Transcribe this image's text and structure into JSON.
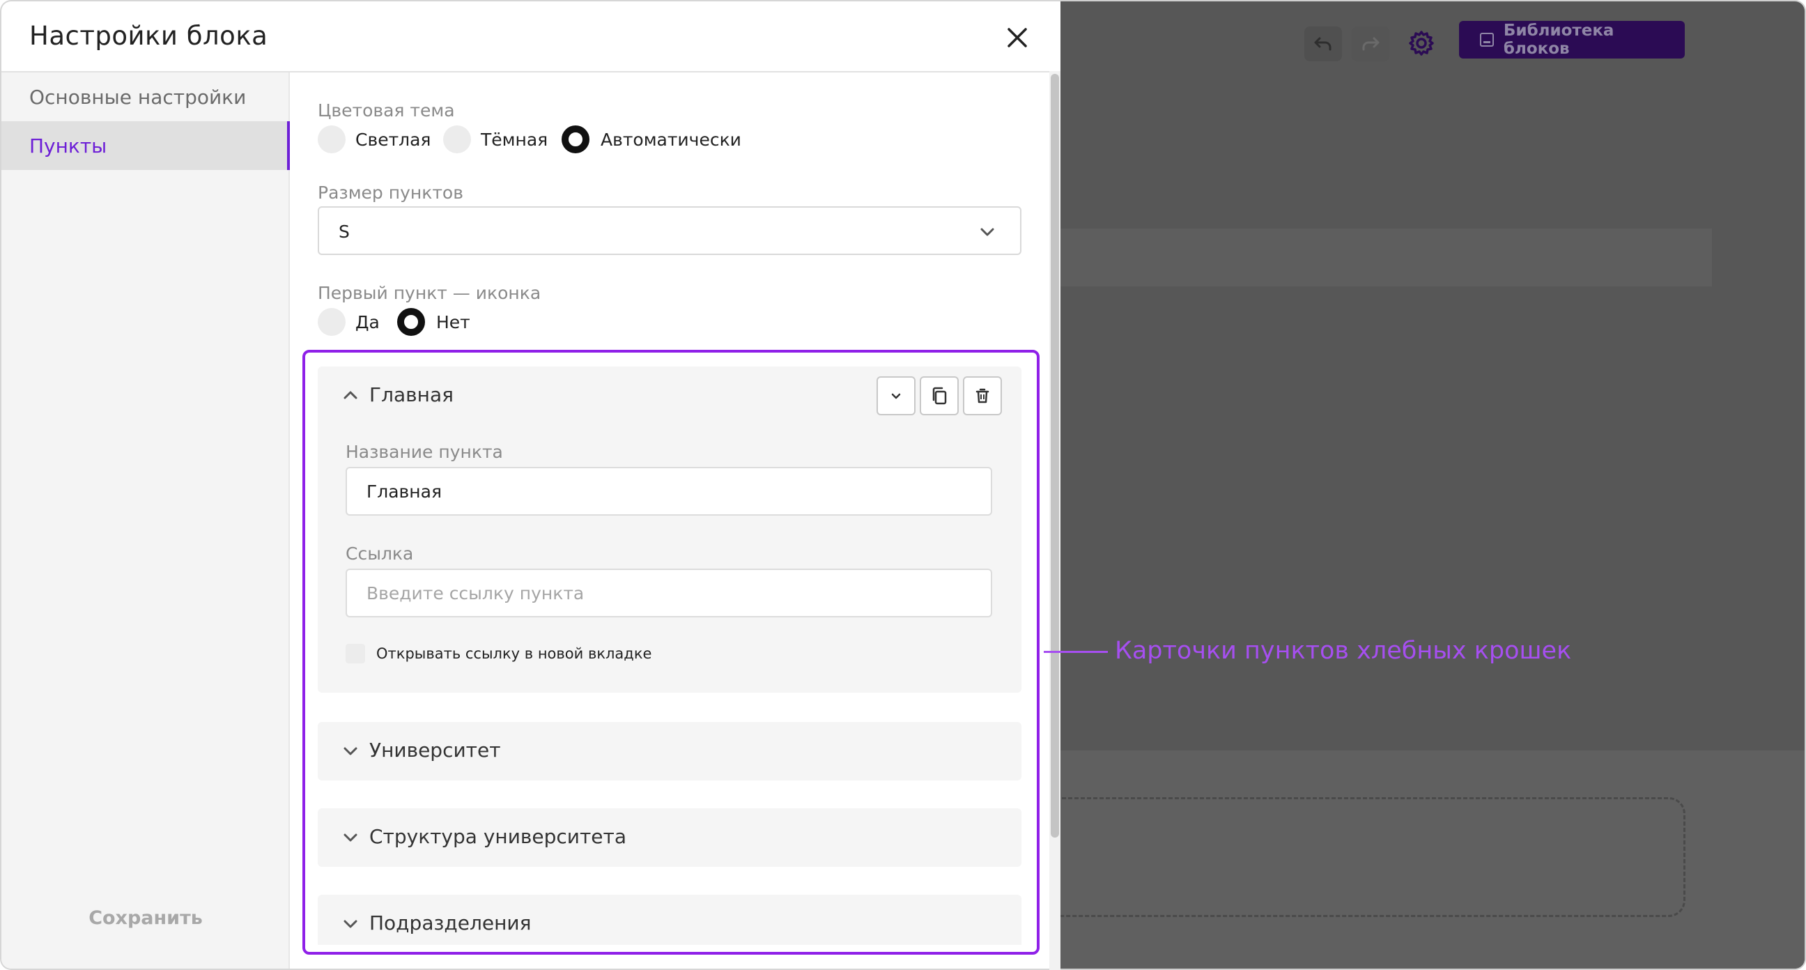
{
  "header": {
    "title": "Настройки блока"
  },
  "sidebar": {
    "items": [
      {
        "label": "Основные настройки"
      },
      {
        "label": "Пункты"
      }
    ],
    "save_label": "Сохранить"
  },
  "settings": {
    "theme": {
      "label": "Цветовая тема",
      "options": [
        "Светлая",
        "Тёмная",
        "Автоматически"
      ],
      "selected": "Автоматически"
    },
    "item_size": {
      "label": "Размер пунктов",
      "value": "S"
    },
    "first_icon": {
      "label": "Первый пункт — иконка",
      "options": [
        "Да",
        "Нет"
      ],
      "selected": "Нет"
    }
  },
  "cards": {
    "expanded": {
      "title": "Главная",
      "name_label": "Название пункта",
      "name_value": "Главная",
      "link_label": "Ссылка",
      "link_placeholder": "Введите ссылку пункта",
      "new_tab_label": "Открывать ссылку в новой вкладке"
    },
    "collapsed": [
      {
        "title": "Университет"
      },
      {
        "title": "Структура университета"
      },
      {
        "title": "Подразделения"
      }
    ]
  },
  "annotation": {
    "text": "Карточки пунктов хлебных крошек"
  },
  "background": {
    "library_button": "Библиотека блоков"
  },
  "colors": {
    "accent": "#6d1fd6",
    "highlight": "#8f20e8",
    "annotation": "#a64ff0",
    "library_bg": "#2b0b54"
  }
}
